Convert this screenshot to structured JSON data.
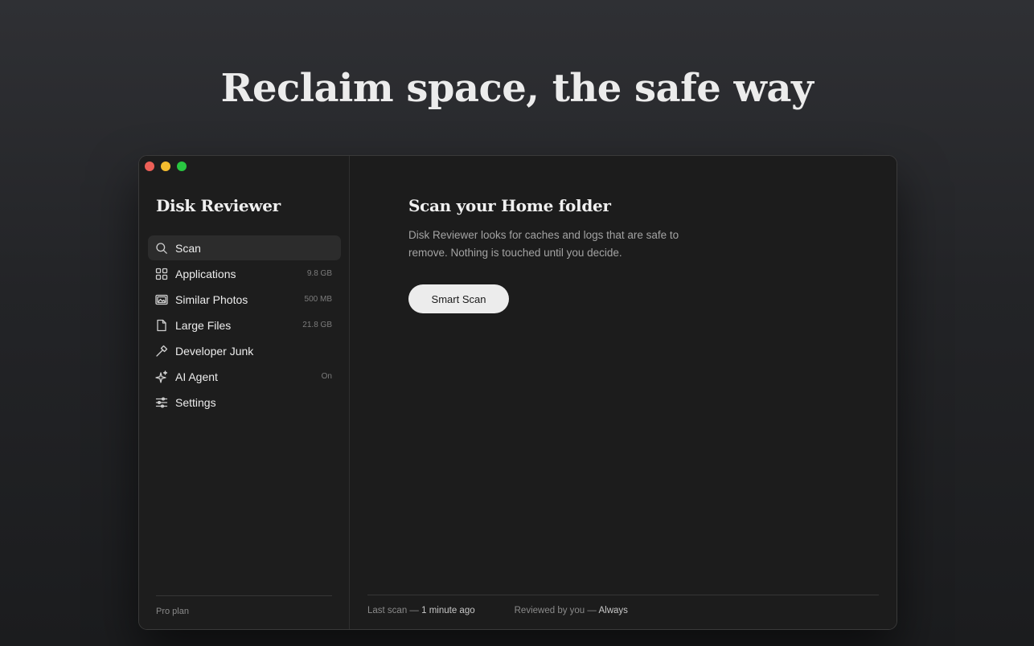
{
  "hero": {
    "title": "Reclaim space, the safe way"
  },
  "window": {
    "app_title": "Disk Reviewer"
  },
  "sidebar": {
    "items": [
      {
        "label": "Scan",
        "meta": "",
        "icon": "search-icon",
        "active": true
      },
      {
        "label": "Applications",
        "meta": "9.8 GB",
        "icon": "grid-icon",
        "active": false
      },
      {
        "label": "Similar Photos",
        "meta": "500 MB",
        "icon": "photos-icon",
        "active": false
      },
      {
        "label": "Large Files",
        "meta": "21.8 GB",
        "icon": "document-icon",
        "active": false
      },
      {
        "label": "Developer Junk",
        "meta": "",
        "icon": "hammer-icon",
        "active": false
      },
      {
        "label": "AI Agent",
        "meta": "On",
        "icon": "sparkle-icon",
        "active": false
      },
      {
        "label": "Settings",
        "meta": "",
        "icon": "sliders-icon",
        "active": false
      }
    ],
    "plan": "Pro plan"
  },
  "main": {
    "heading": "Scan your Home folder",
    "description": "Disk Reviewer looks for caches and logs that are safe to remove. Nothing is touched until you decide.",
    "button_label": "Smart Scan"
  },
  "status": {
    "last_scan_label": "Last scan —",
    "last_scan_value": "1 minute ago",
    "reviewed_label": "Reviewed by you —",
    "reviewed_value": "Always"
  },
  "colors": {
    "traffic_red": "#ed5f57",
    "traffic_yellow": "#f5bd2f",
    "traffic_green": "#29c641",
    "button_bg": "#ececec"
  }
}
